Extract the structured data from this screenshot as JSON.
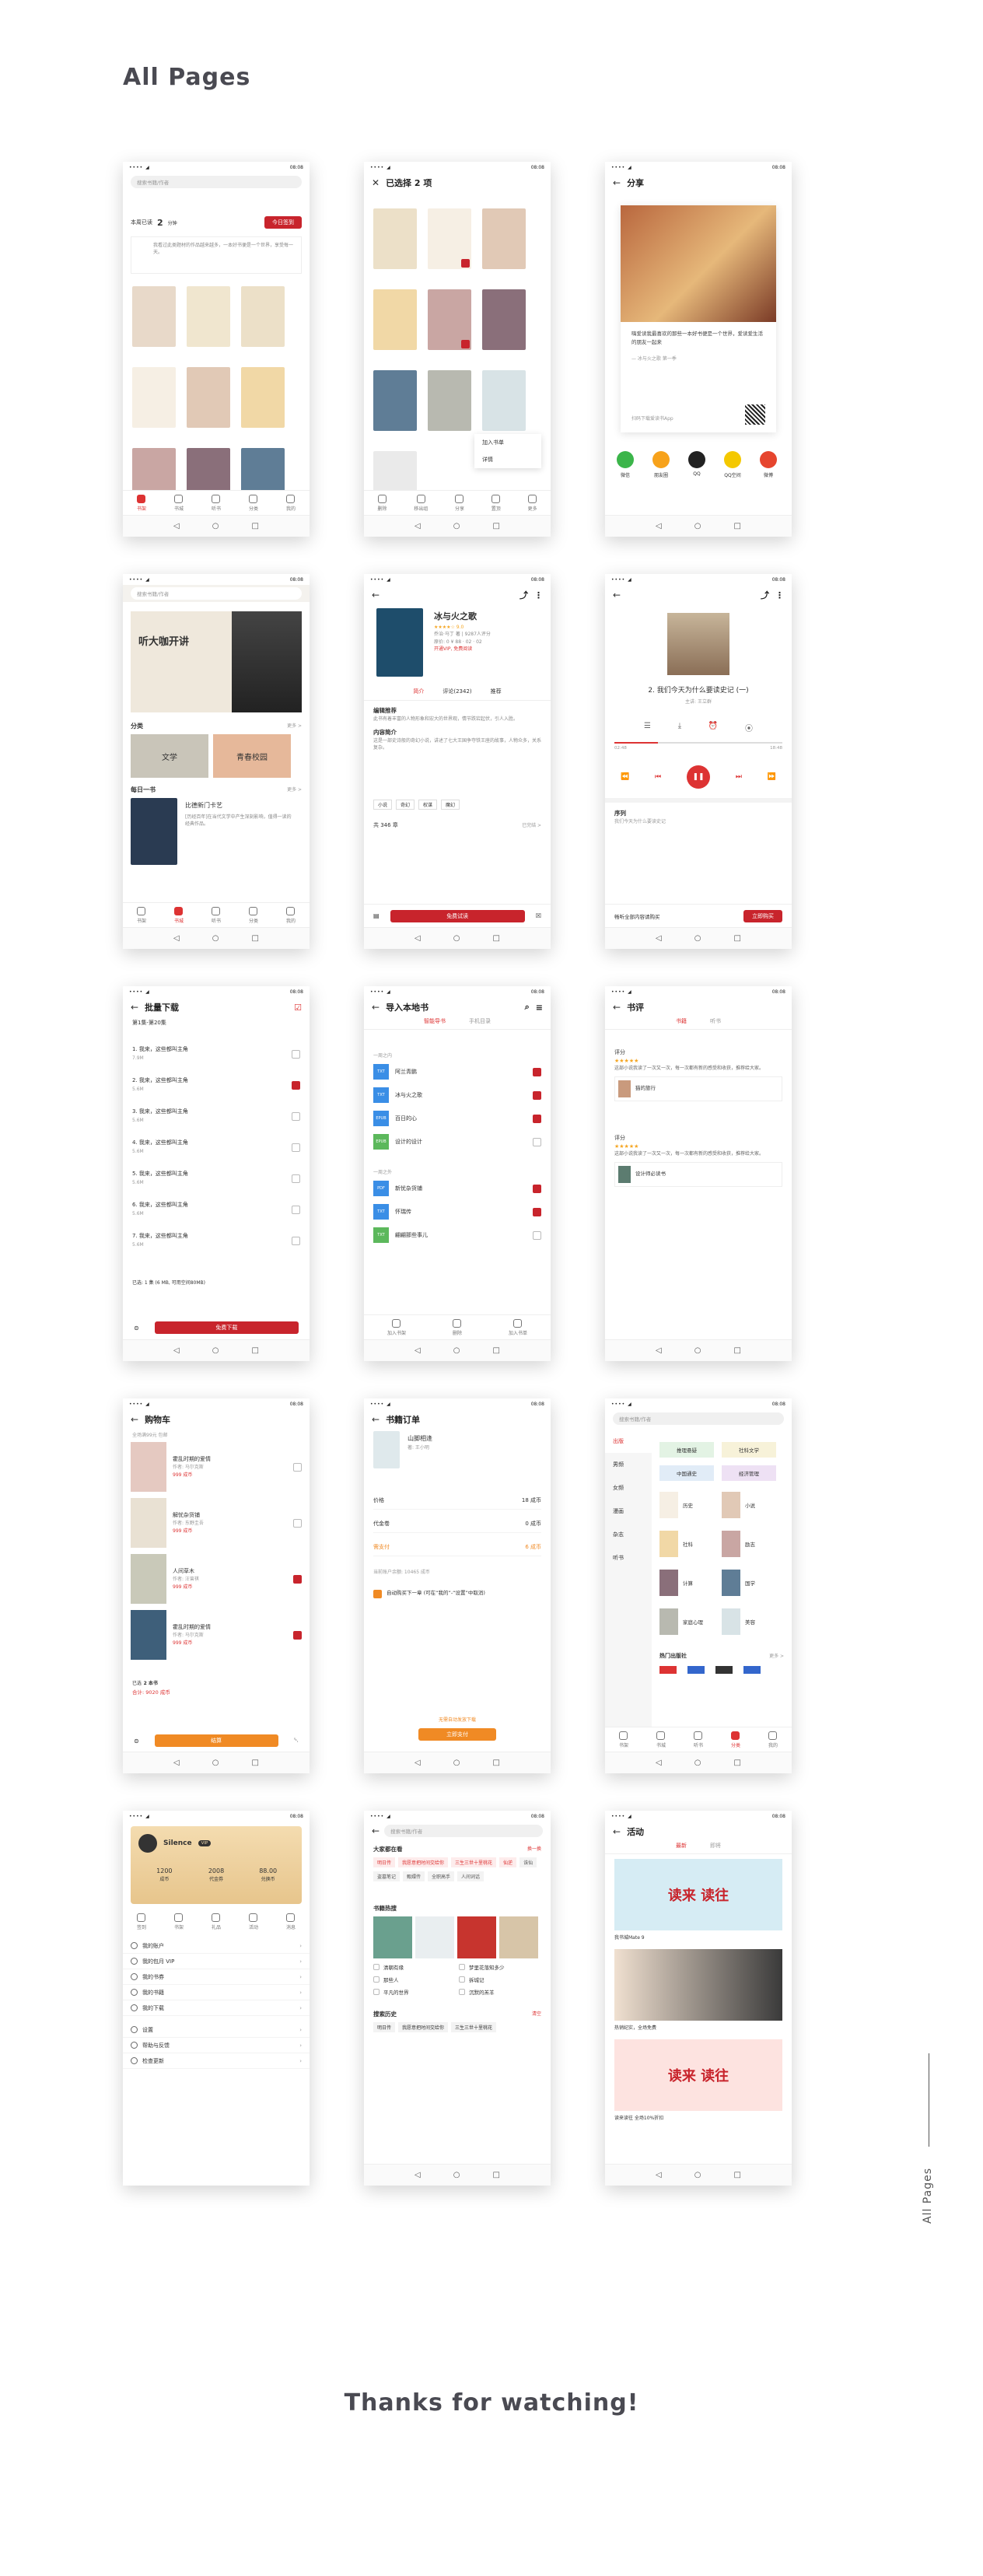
{
  "page": {
    "title": "All Pages",
    "footer": "Thanks for watching!",
    "vertical_label": "All Pages"
  },
  "status": {
    "signal": "•••• ◢",
    "time": "08:08"
  },
  "nav_glyphs": [
    "◁",
    "○",
    "□"
  ],
  "tabs": [
    "书架",
    "书城",
    "听书",
    "分类",
    "我的"
  ],
  "shelf": {
    "search": "搜索书籍/作者",
    "days_label": "本周已读",
    "days": "2",
    "unit": "分钟",
    "btn": "今日签到",
    "notice": "我看过此类题材的作品越来越多，一本好书便是一个世界，享受每一天。"
  },
  "selected": {
    "title": "已选择 2 项",
    "menu": [
      "加入书单",
      "详情"
    ],
    "actions": [
      "删除",
      "移出组",
      "分享",
      "置顶",
      "更多"
    ]
  },
  "share": {
    "title": "分享",
    "quote": "嗨爱读我最喜欢的那些一本好书便是一个世界，爱读爱生活的朋友一起来",
    "source": "— 冰与火之歌 第一季",
    "app_note": "扫码下载爱读书App",
    "targets": [
      "微信",
      "朋友圈",
      "QQ",
      "QQ空间",
      "微博"
    ]
  },
  "store": {
    "search": "搜索书籍/作者",
    "banner": "听大咖开讲",
    "cat_title": "分类",
    "more": "更多 >",
    "cats": [
      "文学",
      "青春校园"
    ],
    "daily_title": "每日一书",
    "daily_book": "比德新门卡艺",
    "daily_desc": "[历经百年]在当代文学中产生深刻影响，值得一读的经典作品。"
  },
  "detail": {
    "book": "冰与火之歌",
    "rating": "★★★★☆ 9.0",
    "meta": "乔治·马丁 著 | 9287人评分",
    "price": "原价: 0 ¥ 88 · 02 · 02",
    "vip": "开通VIP, 免费阅读",
    "tabs": [
      "简介",
      "评论(2342)",
      "推荐"
    ],
    "sec1": "编辑推荐",
    "sec1_text": "此书有着丰富的人物形象和宏大的世界观，情节跌宕起伏，引人入胜。",
    "sec2": "内容简介",
    "sec2_text": "这是一部史诗般的奇幻小说，讲述了七大王国争夺铁王座的故事，人物众多，关系复杂。",
    "tags": [
      "小说",
      "奇幻",
      "权谋",
      "魔幻"
    ],
    "chapters": "共 346 章",
    "status": "已完结 >",
    "btn": "免费试读"
  },
  "player": {
    "title": "2. 我们今天为什么要读史记 (一)",
    "sub": "主讲: 王立群",
    "time_a": "02:48",
    "time_b": "18:48",
    "sec": "序列",
    "sec_text": "我们今天为什么要读史记",
    "buy_text": "畅听全部内容请购买",
    "buy_btn": "立即购买"
  },
  "batch": {
    "title": "批量下载",
    "group": "第1集-第20集",
    "items": [
      {
        "t": "1. 我来，这些都叫主角",
        "s": "7.9M",
        "c": "on"
      },
      {
        "t": "2. 我来，这些都叫主角",
        "s": "5.6M",
        "c": "on"
      },
      {
        "t": "3. 我来，这些都叫主角",
        "s": "5.6M",
        "c": "off"
      },
      {
        "t": "4. 我来，这些都叫主角",
        "s": "5.6M",
        "c": "off"
      },
      {
        "t": "5. 我来，这些都叫主角",
        "s": "5.6M",
        "c": "off"
      },
      {
        "t": "6. 我来，这些都叫主角",
        "s": "5.6M",
        "c": "off"
      },
      {
        "t": "7. 我来，这些都叫主角",
        "s": "5.6M",
        "c": "off"
      }
    ],
    "sel": "已选: 1 集 (6 MB, 可用空间80MB)",
    "btn": "免费下载"
  },
  "local": {
    "title": "导入本地书",
    "tabs": [
      "智能导书",
      "手机目录"
    ],
    "g1": "一周之内",
    "g2": "一周之外",
    "files": [
      {
        "n": "阿兰青鹏",
        "t": "TXT"
      },
      {
        "n": "冰与火之歌",
        "t": "TXT"
      },
      {
        "n": "百日的心",
        "t": "EPUB"
      },
      {
        "n": "设计的设计",
        "t": "EPUB"
      },
      {
        "n": "新忧杂货铺",
        "t": "PDF"
      },
      {
        "n": "怀瑞传",
        "t": "TXT"
      },
      {
        "n": "翩翩那些事儿",
        "t": "TXT"
      }
    ],
    "bottom": [
      "加入书架",
      "删除",
      "加入书单"
    ]
  },
  "review": {
    "title": "书评",
    "tabs": [
      "书籍",
      "听书"
    ],
    "sec": "评分",
    "stars": "★★★★★",
    "text": "这部小说我读了一次又一次，每一次都有新的感受和收获，推荐给大家。",
    "book1": "猫的旅行",
    "book2": "设计师必读书"
  },
  "cart": {
    "title": "购物车",
    "note": "全场满99元 包邮",
    "items": [
      {
        "n": "霍乱时期的爱情",
        "a": "作者: 马尔克斯",
        "p": "999 成币"
      },
      {
        "n": "解忧杂货铺",
        "a": "作者: 东野圭吾",
        "p": "999 成币"
      },
      {
        "n": "人间草木",
        "a": "作者: 汪曾祺",
        "p": "999 成币"
      },
      {
        "n": "霍乱时期的爱情",
        "a": "作者: 马尔克斯",
        "p": "999 成币"
      }
    ],
    "total_label": "已选",
    "total_num": "2 本书",
    "price": "合计: 9020 成币",
    "btn": "结算"
  },
  "order": {
    "title": "书籍订单",
    "book": "山脚相逢",
    "author": "著: 王小明",
    "rows": [
      {
        "k": "价格",
        "v": "18 成币"
      },
      {
        "k": "代金卷",
        "v": "0 成币"
      },
      {
        "k": "需支付",
        "v": "6 成币"
      }
    ],
    "balance": "当前账户余额: 10465 成币",
    "auto": "自动购买下一章 (可在“我的”-“设置”中取消)",
    "notice": "无需自动发放下载",
    "btn": "立即支付"
  },
  "category": {
    "search": "搜索书籍/作者",
    "side": [
      "出版",
      "男频",
      "女频",
      "漫画",
      "杂志",
      "听书"
    ],
    "tags": [
      "推理悬疑",
      "社科文学",
      "中国通史",
      "经济管理"
    ],
    "items": [
      "历史",
      "小说",
      "社科",
      "励志",
      "计算",
      "国学",
      "家庭心理",
      "美容"
    ],
    "pub_title": "热门出版社",
    "pub_more": "更多 >"
  },
  "mine": {
    "name": "Silence",
    "badge": "VIP",
    "stats": [
      {
        "v": "1200",
        "k": "成币"
      },
      {
        "v": "2008",
        "k": "代金券"
      },
      {
        "v": "88.00",
        "k": "兑换币"
      }
    ],
    "icons": [
      "签到",
      "书架",
      "礼品",
      "活动",
      "消息"
    ],
    "menu": [
      "我的账户",
      "我的包月 VIP",
      "我的书券",
      "我的书籍",
      "我的下载",
      "设置",
      "帮助与反馈",
      "检查更新"
    ]
  },
  "searchpage": {
    "search": "搜索书籍/作者",
    "hot_title": "大家都在看",
    "hot_more": "换一换",
    "hot_tags": [
      "明日传",
      "我愿意把时间交给你",
      "三生三世十里桃花",
      "仙逆",
      "诛仙",
      "盗墓笔记",
      "甄嬛传",
      "全职高手",
      "人间词话"
    ],
    "rank_title": "书籍热搜",
    "rank": [
      "清朝有缘",
      "梦里花落知多少",
      "那些人",
      "拆城记",
      "平凡的世界",
      "沉默的羔羊"
    ],
    "hist_title": "搜索历史",
    "hist_clear": "清空",
    "hist": [
      "明日传",
      "我愿意把时间交给你",
      "三生三世十里桃花"
    ]
  },
  "activity": {
    "title": "活动",
    "tabs": [
      "最新",
      "即将"
    ],
    "banner1": "读来 读往",
    "cap1": "我书城Mate 9",
    "cap2": "热销纪实，全场免费",
    "banner3": "读来 读往",
    "cap3": "读来读往 全场10%折扣"
  }
}
